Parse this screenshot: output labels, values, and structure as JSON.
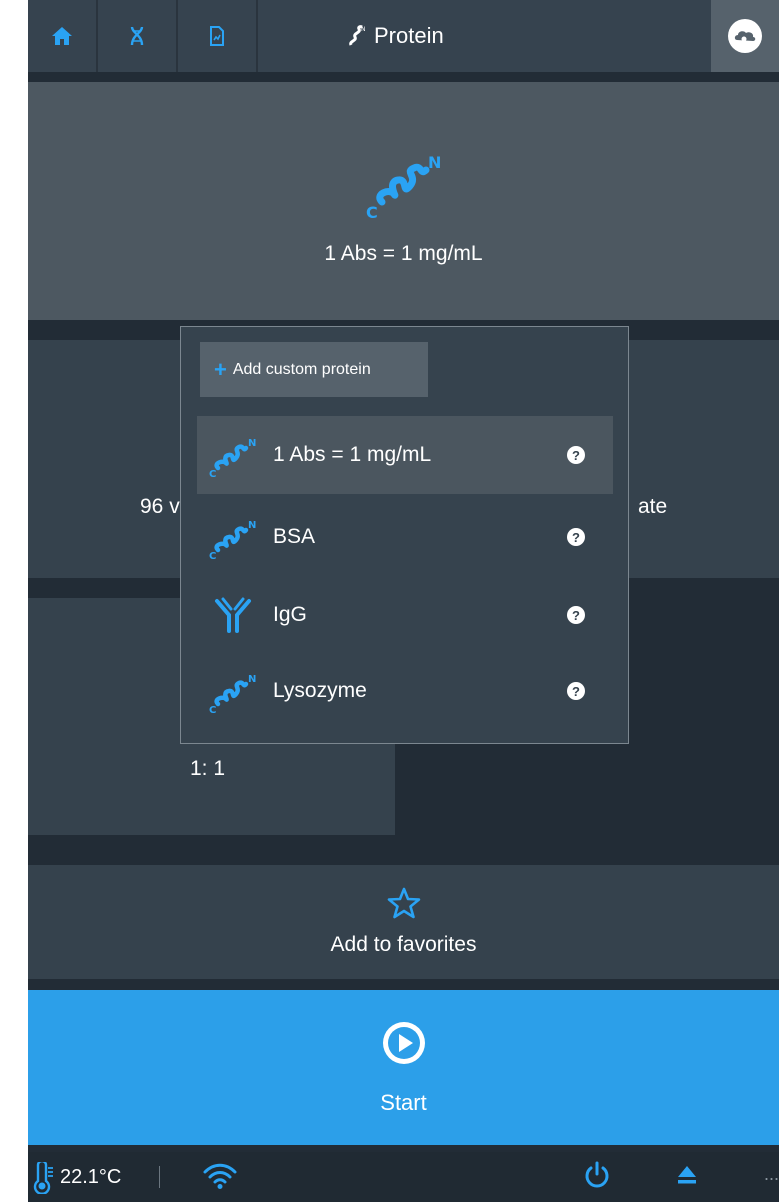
{
  "header": {
    "title": "Protein",
    "home_icon": "home-icon",
    "dna_icon": "dna-icon",
    "report_icon": "report-icon",
    "cloud_icon": "cloud-icon"
  },
  "method_tile": {
    "label": "1 Abs = 1 mg/mL"
  },
  "sample_tile": {
    "left_text": "96 v",
    "right_text": "ate"
  },
  "ratio_tile": {
    "value": "1: 1"
  },
  "dropdown": {
    "add_label": "Add custom protein",
    "options": [
      {
        "label": "1 Abs = 1 mg/mL",
        "icon": "protein-helix-icon",
        "selected": true
      },
      {
        "label": "BSA",
        "icon": "protein-helix-icon",
        "selected": false
      },
      {
        "label": "IgG",
        "icon": "antibody-icon",
        "selected": false
      },
      {
        "label": "Lysozyme",
        "icon": "protein-helix-icon",
        "selected": false
      }
    ],
    "help_glyph": "?"
  },
  "favorites": {
    "label": "Add to favorites"
  },
  "start": {
    "label": "Start"
  },
  "status": {
    "temperature": "22.1°C",
    "more": "..."
  },
  "colors": {
    "accent": "#2c9fe9",
    "icon_blue": "#2aa3f4",
    "background": "#222c36"
  }
}
